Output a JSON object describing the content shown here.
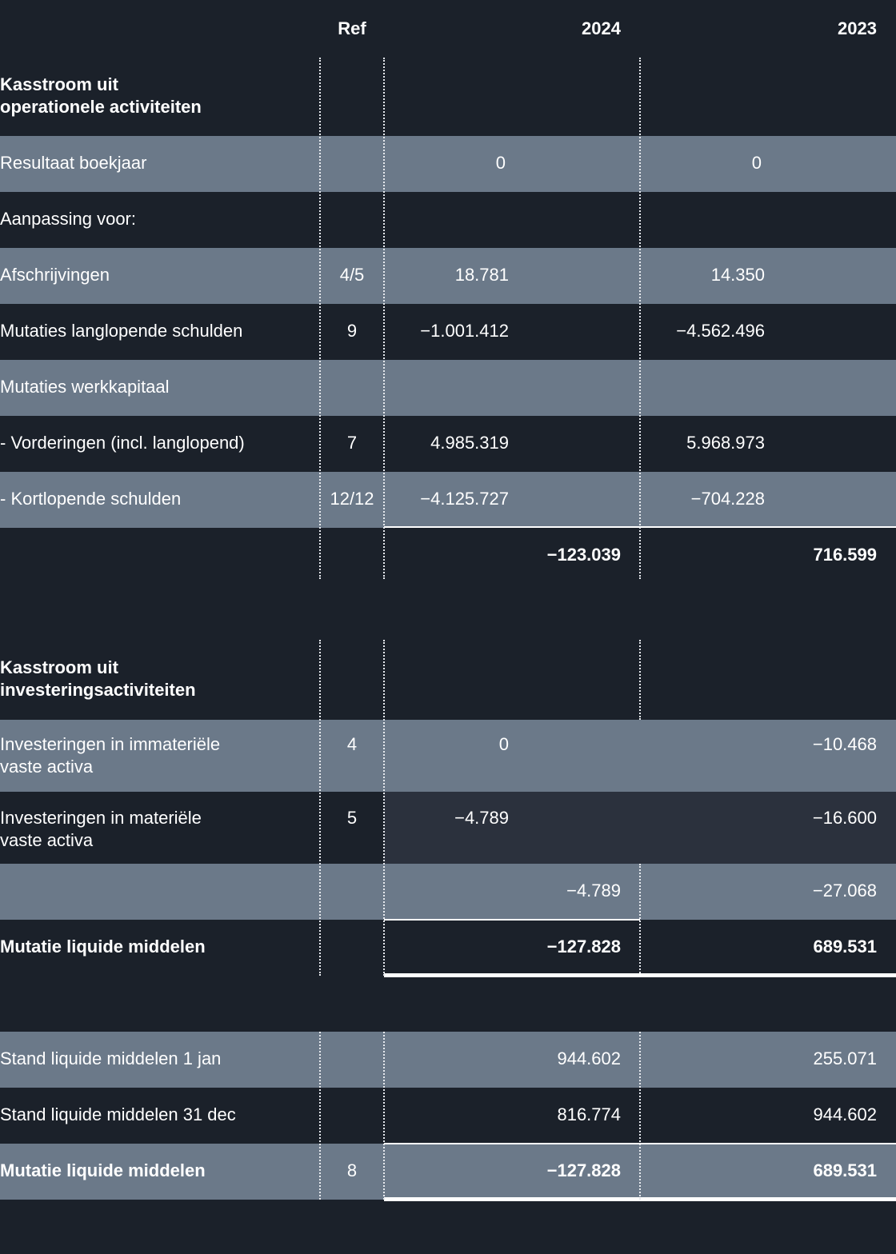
{
  "header": {
    "ref": "Ref",
    "y1": "2024",
    "y2": "2023"
  },
  "op": {
    "title_1": "Kasstroom uit",
    "title_2": "operationele activiteiten",
    "r1": {
      "label": "Resultaat boekjaar",
      "ref": "",
      "a": "0",
      "b": "0"
    },
    "r2": {
      "label": "Aanpassing voor:"
    },
    "r3": {
      "label": "Afschrijvingen",
      "ref": "4/5",
      "a": "18.781",
      "b": "14.350"
    },
    "r4": {
      "label": "Mutaties langlopende schulden",
      "ref": "9",
      "a": "−1.001.412",
      "b": "−4.562.496"
    },
    "r5": {
      "label": "Mutaties werkkapitaal"
    },
    "r6": {
      "label": "- Vorderingen (incl. langlopend)",
      "ref": "7",
      "a": "4.985.319",
      "b": "5.968.973"
    },
    "r7": {
      "label": "- Kortlopende schulden",
      "ref": "12/12",
      "a": "−4.125.727",
      "b": "−704.228"
    },
    "total": {
      "a": "−123.039",
      "b": "716.599"
    }
  },
  "inv": {
    "title_1": "Kasstroom uit",
    "title_2": "investeringsactiviteiten",
    "r1": {
      "label_1": "Investeringen in immateriële",
      "label_2": "vaste activa",
      "ref": "4",
      "a": "0",
      "b": "−10.468"
    },
    "r2": {
      "label_1": "Investeringen in materiële",
      "label_2": "vaste activa",
      "ref": "5",
      "a": "−4.789",
      "b": "−16.600"
    },
    "subtotal": {
      "a": "−4.789",
      "b": "−27.068"
    },
    "mutatie": {
      "label": "Mutatie liquide middelen",
      "a": "−127.828",
      "b": "689.531"
    }
  },
  "cash": {
    "r1": {
      "label": "Stand liquide middelen 1 jan",
      "a": "944.602",
      "b": "255.071"
    },
    "r2": {
      "label": "Stand liquide middelen 31 dec",
      "a": "816.774",
      "b": "944.602"
    },
    "mutatie": {
      "label": "Mutatie liquide middelen",
      "ref": "8",
      "a": "−127.828",
      "b": "689.531"
    }
  },
  "colors": {
    "background": "#1b212a",
    "row_light": "#6b7989",
    "row_mid": "#2b313d",
    "text": "#ffffff"
  }
}
